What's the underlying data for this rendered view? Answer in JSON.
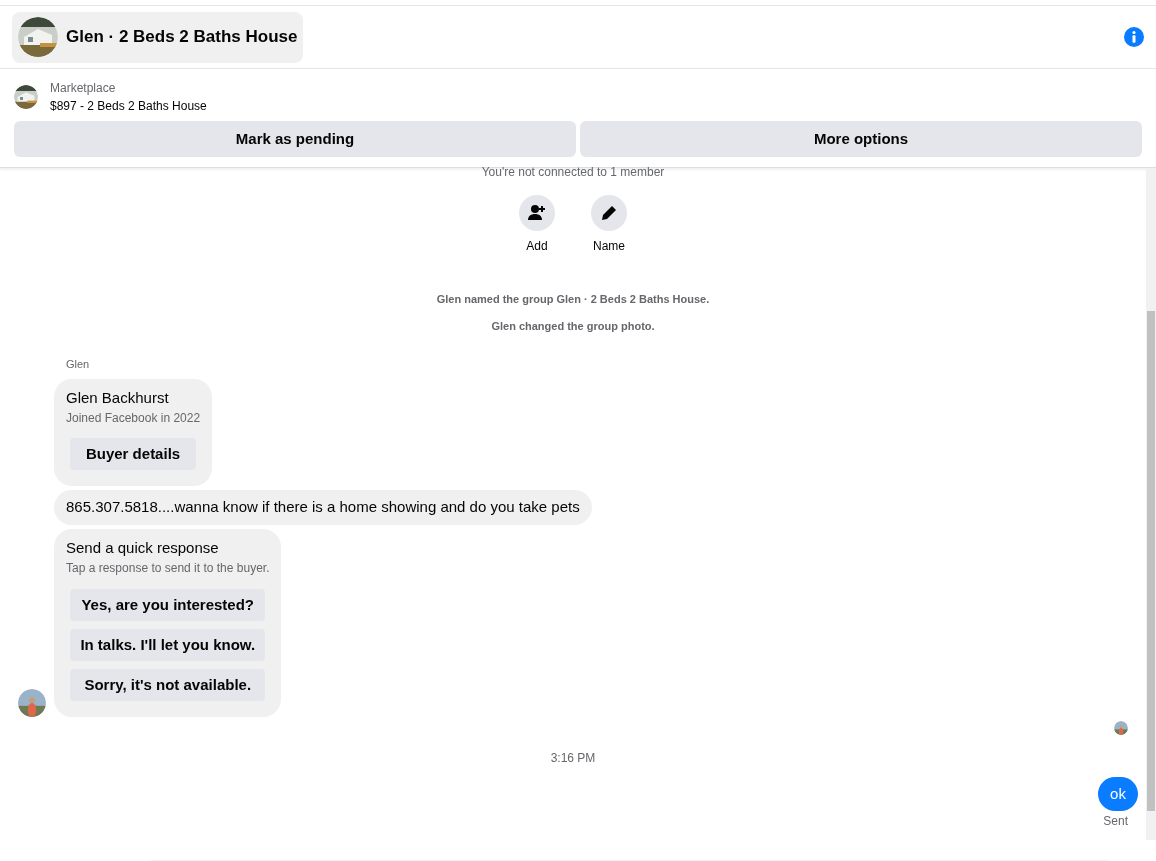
{
  "header": {
    "title": "Glen · 2 Beds 2 Baths House"
  },
  "listing": {
    "source": "Marketplace",
    "summary": "$897 - 2 Beds 2 Baths House"
  },
  "actions": [
    "Mark as pending",
    "More options"
  ],
  "chat": {
    "notice": "You're not connected to 1 member",
    "group_actions": [
      {
        "kind": "add",
        "label": "Add"
      },
      {
        "kind": "name",
        "label": "Name"
      }
    ],
    "events": [
      "Glen named the group Glen · 2 Beds 2 Baths House.",
      "Glen changed the group photo."
    ],
    "sender": "Glen",
    "profile": {
      "name": "Glen Backhurst",
      "joined": "Joined Facebook in 2022",
      "button": "Buyer details"
    },
    "message": "865.307.5818....wanna know if there is a home showing and do you take pets",
    "quick": {
      "title": "Send a quick response",
      "hint": "Tap a response to send it to the buyer.",
      "responses": [
        "Yes, are you interested?",
        "In talks. I'll let you know.",
        "Sorry, it's not available."
      ]
    },
    "time": "3:16 PM",
    "outgoing": {
      "text": "ok",
      "status": "Sent"
    }
  }
}
